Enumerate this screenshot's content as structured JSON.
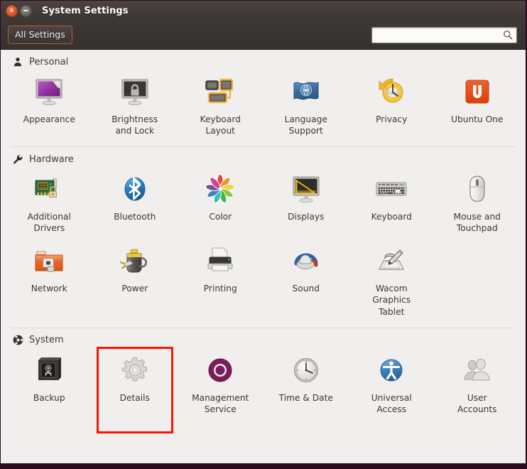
{
  "window": {
    "title": "System Settings",
    "close_label": "x",
    "minimize_label": "–"
  },
  "toolbar": {
    "all_settings_label": "All Settings",
    "search_value": "",
    "search_placeholder": ""
  },
  "colors": {
    "titlebar": "#3c3734",
    "toolbar": "#36312e",
    "content_bg": "#f0efed",
    "accent_orange": "#dd4814",
    "highlight_red": "#fb1405",
    "bottom_strip": "#2c0b1f"
  },
  "sections": [
    {
      "id": "personal",
      "title": "Personal",
      "icon": "person-icon",
      "items": [
        {
          "label": "Appearance",
          "icon": "appearance-icon"
        },
        {
          "label": "Brightness\nand Lock",
          "icon": "brightness-lock-icon"
        },
        {
          "label": "Keyboard\nLayout",
          "icon": "keyboard-layout-icon"
        },
        {
          "label": "Language\nSupport",
          "icon": "language-support-icon"
        },
        {
          "label": "Privacy",
          "icon": "privacy-icon"
        },
        {
          "label": "Ubuntu One",
          "icon": "ubuntu-one-icon"
        }
      ]
    },
    {
      "id": "hardware",
      "title": "Hardware",
      "icon": "wrench-icon",
      "items": [
        {
          "label": "Additional\nDrivers",
          "icon": "additional-drivers-icon"
        },
        {
          "label": "Bluetooth",
          "icon": "bluetooth-icon"
        },
        {
          "label": "Color",
          "icon": "color-icon"
        },
        {
          "label": "Displays",
          "icon": "displays-icon"
        },
        {
          "label": "Keyboard",
          "icon": "keyboard-icon"
        },
        {
          "label": "Mouse and\nTouchpad",
          "icon": "mouse-touchpad-icon"
        },
        {
          "label": "Network",
          "icon": "network-icon"
        },
        {
          "label": "Power",
          "icon": "power-icon"
        },
        {
          "label": "Printing",
          "icon": "printing-icon"
        },
        {
          "label": "Sound",
          "icon": "sound-icon"
        },
        {
          "label": "Wacom\nGraphics\nTablet",
          "icon": "wacom-tablet-icon"
        }
      ]
    },
    {
      "id": "system",
      "title": "System",
      "icon": "ubuntu-circle-icon",
      "items": [
        {
          "label": "Backup",
          "icon": "backup-icon"
        },
        {
          "label": "Details",
          "icon": "details-gear-icon",
          "highlighted": true
        },
        {
          "label": "Management\nService",
          "icon": "management-service-icon"
        },
        {
          "label": "Time & Date",
          "icon": "time-date-icon"
        },
        {
          "label": "Universal\nAccess",
          "icon": "universal-access-icon"
        },
        {
          "label": "User\nAccounts",
          "icon": "user-accounts-icon"
        }
      ]
    }
  ]
}
